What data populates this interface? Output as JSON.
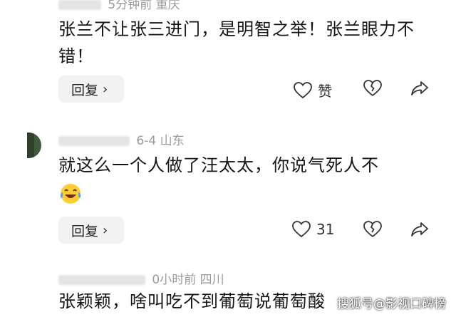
{
  "comments": [
    {
      "meta_location_text": "5分钟前 重庆",
      "text": "张兰不让张三进门，是明智之举！张兰眼力不错！",
      "reply_label": "回复",
      "like_label": "赞",
      "like_count": ""
    },
    {
      "meta_location_text": "6-4 山东",
      "text": "就这么一个人做了汪太太，你说气死人不",
      "emoji_name": "laughing-tears-emoji",
      "reply_label": "回复",
      "like_count": "31"
    },
    {
      "meta_location_text": "0小时前 四川",
      "text": "张颖颖，啥叫吃不到葡萄说葡萄酸"
    }
  ],
  "watermark": "搜狐号@影视口碑榜",
  "icons": {
    "like": "heart-outline-icon",
    "dislike": "broken-heart-icon",
    "share": "share-arrow-icon",
    "chevron": "chevron-right-icon"
  }
}
